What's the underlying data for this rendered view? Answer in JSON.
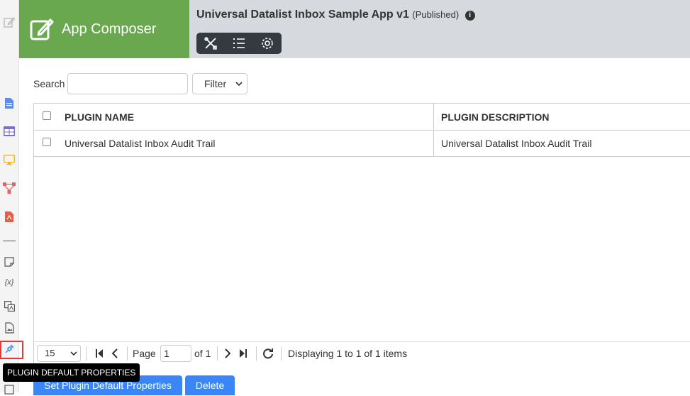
{
  "brand": {
    "title": "App Composer"
  },
  "app": {
    "name": "Universal Datalist Inbox Sample App v1",
    "status": "(Published)"
  },
  "rail": {
    "items": [
      "edit-icon",
      "document-icon",
      "table-icon",
      "monitor-icon",
      "process-icon",
      "pdf-icon",
      "note-icon",
      "variable-icon",
      "translate-icon",
      "image-icon",
      "plugin-icon"
    ],
    "variable_glyph": "{x}"
  },
  "tooltip": {
    "text": "PLUGIN DEFAULT PROPERTIES"
  },
  "search": {
    "label": "Search",
    "value": "",
    "filter_label": "Filter"
  },
  "table": {
    "columns": [
      "PLUGIN NAME",
      "PLUGIN DESCRIPTION"
    ],
    "rows": [
      {
        "name": "Universal Datalist Inbox Audit Trail",
        "description": "Universal Datalist Inbox Audit Trail",
        "checked": false
      }
    ]
  },
  "pager": {
    "page_size": "15",
    "page_label": "Page",
    "page_value": "1",
    "of_label": "of 1",
    "display_text": "Displaying 1 to 1 of 1 items"
  },
  "actions": {
    "set_default": "Set Plugin Default Properties",
    "delete": "Delete"
  },
  "colors": {
    "brand_green": "#6aa84f",
    "appbar": "#d6d9de",
    "toolbar": "#343a40",
    "primary_button": "#3b86f7",
    "highlight": "#e53935"
  }
}
